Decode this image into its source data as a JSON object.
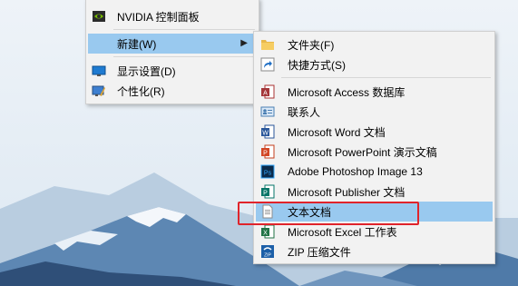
{
  "context_menu": {
    "items": [
      {
        "label": "NVIDIA 控制面板",
        "icon": "nvidia-icon"
      },
      {
        "label": "新建(W)",
        "icon": "",
        "has_submenu": true
      },
      {
        "label": "显示设置(D)",
        "icon": "display-settings-icon"
      },
      {
        "label": "个性化(R)",
        "icon": "personalize-icon"
      }
    ]
  },
  "new_submenu": {
    "items": [
      {
        "label": "文件夹(F)",
        "icon": "folder-icon"
      },
      {
        "label": "快捷方式(S)",
        "icon": "shortcut-icon"
      },
      {
        "label": "Microsoft Access 数据库",
        "icon": "access-icon"
      },
      {
        "label": "联系人",
        "icon": "contact-icon"
      },
      {
        "label": "Microsoft Word 文档",
        "icon": "word-icon"
      },
      {
        "label": "Microsoft PowerPoint 演示文稿",
        "icon": "powerpoint-icon"
      },
      {
        "label": "Adobe Photoshop Image 13",
        "icon": "photoshop-icon"
      },
      {
        "label": "Microsoft Publisher 文档",
        "icon": "publisher-icon"
      },
      {
        "label": "文本文档",
        "icon": "text-document-icon",
        "highlighted": true
      },
      {
        "label": "Microsoft Excel 工作表",
        "icon": "excel-icon"
      },
      {
        "label": "ZIP 压缩文件",
        "icon": "zip-icon"
      }
    ]
  },
  "colors": {
    "highlight": "#99c9ef",
    "annotation_box": "#e0242b"
  }
}
